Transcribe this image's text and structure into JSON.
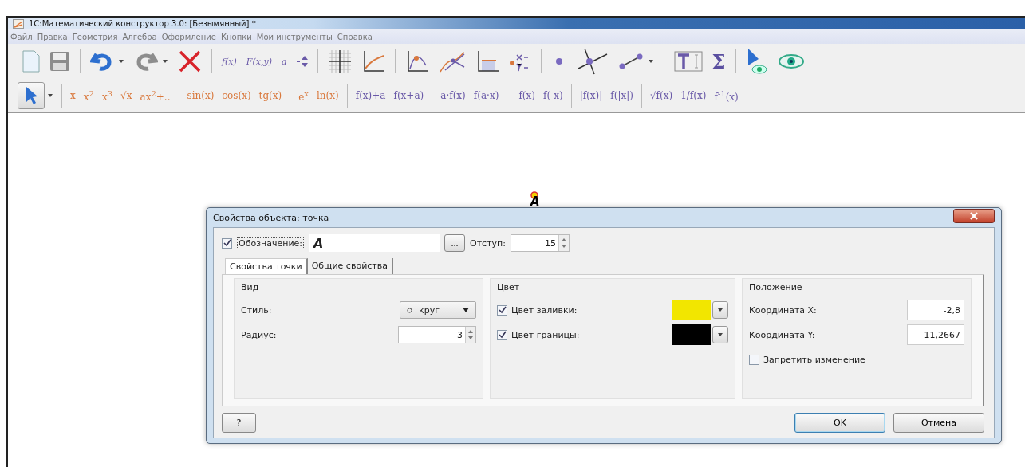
{
  "window": {
    "title": "1С:Математический конструктор 3.0: [Безымянный] *"
  },
  "menu": [
    "Файл",
    "Правка",
    "Геометрия",
    "Алгебра",
    "Оформление",
    "Кнопки",
    "Мои инструменты",
    "Справка"
  ],
  "toolbar": {
    "text_buttons": [
      "f(x)",
      "F(x,y)",
      "a"
    ],
    "sigma": "Σ"
  },
  "function_groups": [
    [
      {
        "label": "x",
        "color": "#d9783c"
      },
      {
        "label": "x$^{2}$",
        "color": "#d9783c"
      },
      {
        "label": "x$^{3}$",
        "color": "#d9783c"
      },
      {
        "label": "√x",
        "color": "#d9783c"
      },
      {
        "label": "ax$^{2}$+..",
        "color": "#d9783c"
      }
    ],
    [
      {
        "label": "sin(x)",
        "color": "#d9783c"
      },
      {
        "label": "cos(x)",
        "color": "#d9783c"
      },
      {
        "label": "tg(x)",
        "color": "#d9783c"
      }
    ],
    [
      {
        "label": "e$^{x}$",
        "color": "#d9783c"
      },
      {
        "label": "ln(x)",
        "color": "#d9783c"
      }
    ],
    [
      {
        "label": "f(x)+a",
        "color": "#6a5aa8"
      },
      {
        "label": "f(x+a)",
        "color": "#6a5aa8"
      }
    ],
    [
      {
        "label": "a·f(x)",
        "color": "#6a5aa8"
      },
      {
        "label": "f(a·x)",
        "color": "#6a5aa8"
      }
    ],
    [
      {
        "label": "-f(x)",
        "color": "#6a5aa8"
      },
      {
        "label": "f(-x)",
        "color": "#6a5aa8"
      }
    ],
    [
      {
        "label": "|f(x)|",
        "color": "#6a5aa8"
      },
      {
        "label": "f(|x|)",
        "color": "#6a5aa8"
      }
    ],
    [
      {
        "label": "√f(x)",
        "color": "#6a5aa8"
      },
      {
        "label": "1/f(x)",
        "color": "#6a5aa8"
      },
      {
        "label": "f$^{-1}$(x)",
        "color": "#6a5aa8"
      }
    ]
  ],
  "canvas": {
    "point_label": "A"
  },
  "dialog": {
    "title": "Свойства объекта: точка",
    "designation": {
      "label": "Обозначение:",
      "checked": true,
      "value": "A",
      "browse": "..."
    },
    "offset": {
      "label": "Отступ:",
      "value": "15"
    },
    "tabs": [
      {
        "label": "Свойства точки",
        "selected": true
      },
      {
        "label": "Общие свойства",
        "selected": false
      }
    ],
    "view": {
      "title": "Вид",
      "style_label": "Стиль:",
      "style_value": "круг",
      "radius_label": "Радиус:",
      "radius_value": "3"
    },
    "color": {
      "title": "Цвет",
      "rows": [
        {
          "label": "Цвет заливки:",
          "checked": true,
          "color": "#f2e600"
        },
        {
          "label": "Цвет границы:",
          "checked": true,
          "color": "#000000"
        }
      ]
    },
    "position": {
      "title": "Положение",
      "x_label": "Координата X:",
      "x_value": "-2,8",
      "y_label": "Координата Y:",
      "y_value": "11,2667",
      "lock": {
        "label": "Запретить изменение",
        "checked": false
      }
    },
    "help": "?",
    "ok": "OK",
    "cancel": "Отмена"
  }
}
